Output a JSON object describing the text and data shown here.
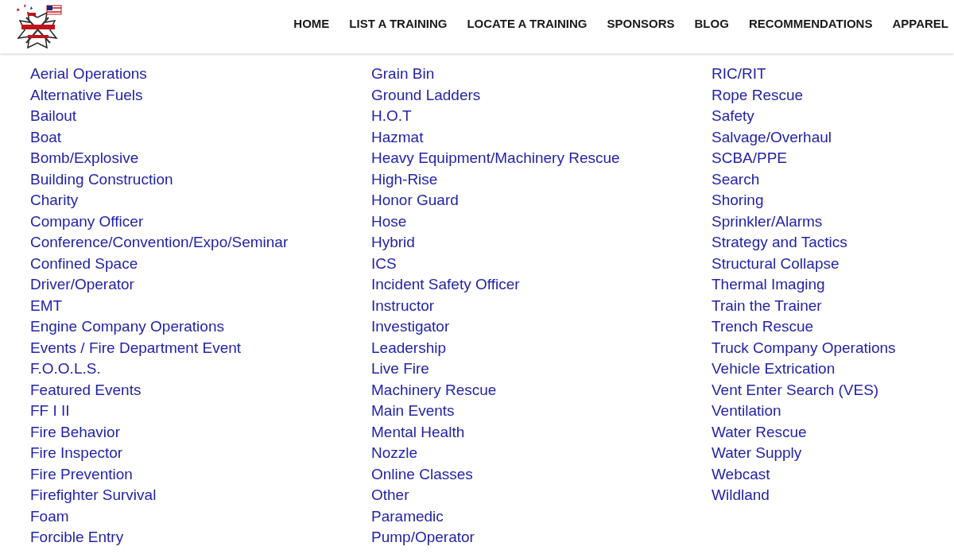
{
  "header": {
    "nav": [
      {
        "label": "HOME"
      },
      {
        "label": "LIST A TRAINING"
      },
      {
        "label": "LOCATE A TRAINING"
      },
      {
        "label": "SPONSORS"
      },
      {
        "label": "BLOG"
      },
      {
        "label": "RECOMMENDATIONS"
      },
      {
        "label": "APPAREL"
      }
    ]
  },
  "categories": [
    [
      "Aerial Operations",
      "Alternative Fuels",
      "Bailout",
      "Boat",
      "Bomb/Explosive",
      "Building Construction",
      "Charity",
      "Company Officer",
      "Conference/Convention/Expo/Seminar",
      "Confined Space",
      "Driver/Operator",
      "EMT",
      "Engine Company Operations",
      "Events / Fire Department Event",
      "F.O.O.L.S.",
      "Featured Events",
      "FF I II",
      "Fire Behavior",
      "Fire Inspector",
      "Fire Prevention",
      "Firefighter Survival",
      "Foam",
      "Forcible Entry"
    ],
    [
      "Grain Bin",
      "Ground Ladders",
      "H.O.T",
      "Hazmat",
      "Heavy Equipment/Machinery Rescue",
      "High-Rise",
      "Honor Guard",
      "Hose",
      "Hybrid",
      "ICS",
      "Incident Safety Officer",
      "Instructor",
      "Investigator",
      "Leadership",
      "Live Fire",
      "Machinery Rescue",
      "Main Events",
      "Mental Health",
      "Nozzle",
      "Online Classes",
      "Other",
      "Paramedic",
      "Pump/Operator"
    ],
    [
      "RIC/RIT",
      "Rope Rescue",
      "Safety",
      "Salvage/Overhaul",
      "SCBA/PPE",
      "Search",
      "Shoring",
      "Sprinkler/Alarms",
      "Strategy and Tactics",
      "Structural Collapse",
      "Thermal Imaging",
      "Train the Trainer",
      "Trench Rescue",
      "Truck Company Operations",
      "Vehicle Extrication",
      "Vent Enter Search (VES)",
      "Ventilation",
      "Water Rescue",
      "Water Supply",
      "Webcast",
      "Wildland"
    ]
  ]
}
